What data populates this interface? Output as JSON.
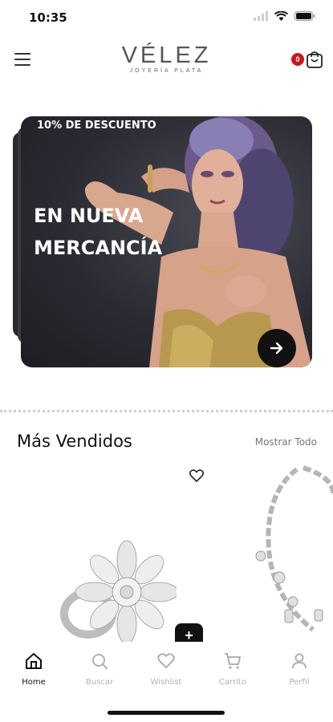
{
  "status_bar": {
    "time": "10:35"
  },
  "header": {
    "logo_name": "VÉLEZ",
    "logo_subtitle": "JOYERÍA PLATA",
    "cart_count": "0"
  },
  "banner": {
    "discount": "10% DE DESCUENTO",
    "title_line1": "EN NUEVA",
    "title_line2": "MERCANCÍA"
  },
  "section": {
    "title": "Más Vendidos",
    "link": "Mostrar Todo"
  },
  "product": {
    "add_label": "+"
  },
  "nav": {
    "items": [
      {
        "label": "Home",
        "icon": "home-icon",
        "active": true
      },
      {
        "label": "Buscar",
        "icon": "search-icon",
        "active": false
      },
      {
        "label": "Wishlist",
        "icon": "heart-icon",
        "active": false
      },
      {
        "label": "Carrito",
        "icon": "cart-icon",
        "active": false
      },
      {
        "label": "Perfil",
        "icon": "user-icon",
        "active": false
      }
    ]
  },
  "colors": {
    "badge": "#d0141c",
    "active_nav": "#111111",
    "inactive_nav": "#b0b0b0"
  }
}
